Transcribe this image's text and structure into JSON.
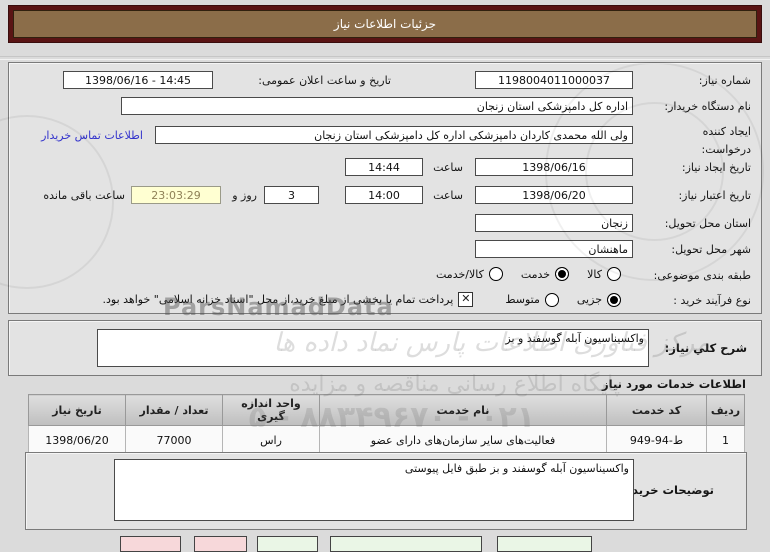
{
  "title_bar": {
    "title": "جزئیات اطلاعات نیاز"
  },
  "form": {
    "need_number": {
      "label": "شماره نیاز:",
      "value": "1198004011000037"
    },
    "announce": {
      "label": "تاریخ و ساعت اعلان عمومی:",
      "value": "1398/06/16 - 14:45"
    },
    "buyer_org": {
      "label": "نام دستگاه خریدار:",
      "value": "اداره کل دامپزشکی استان زنجان"
    },
    "creator": {
      "label": "ایجاد کننده درخواست:",
      "value": "ولی الله محمدی کاردان دامپزشکی  اداره کل دامپزشکی استان زنجان",
      "contact_link": "اطلاعات تماس خریدار"
    },
    "created_date": {
      "label": "تاریخ ایجاد نیاز:",
      "date": "1398/06/16",
      "time_label": "ساعت",
      "time": "14:44"
    },
    "valid_date": {
      "label": "تاریخ اعتبار نیاز:",
      "date": "1398/06/20",
      "time_label": "ساعت",
      "time": "14:00"
    },
    "countdown": {
      "days": "3",
      "days_label": "روز و",
      "time": "23:03:29",
      "time_label": "ساعت باقی مانده"
    },
    "province": {
      "label": "استان محل تحویل:",
      "value": "زنجان"
    },
    "city": {
      "label": "شهر محل تحویل:",
      "value": "ماهنشان"
    },
    "subject_class": {
      "label": "طبقه بندی موضوعی:",
      "options": [
        {
          "label": "کالا",
          "checked": false
        },
        {
          "label": "خدمت",
          "checked": true
        },
        {
          "label": "کالا/خدمت",
          "checked": false
        }
      ]
    },
    "process_type": {
      "label": "نوع فرآیند خرید :",
      "options": [
        {
          "label": "جزیی",
          "checked": true
        },
        {
          "label": "متوسط",
          "checked": false
        }
      ],
      "treasury_checked": true,
      "treasury_note": "پرداخت تمام یا بخشی از مبلغ خرید،از محل \"اسناد خزانه اسلامی\" خواهد بود."
    }
  },
  "need_desc": {
    "label": "شرح كلي نياز:",
    "value": "واکسیناسیون آبله گوسفند و بز"
  },
  "services": {
    "header": "اطلاعات خدمات مورد نياز",
    "table": {
      "columns": [
        "ردیف",
        "کد خدمت",
        "نام خدمت",
        "واحد اندازه گیری",
        "تعداد / مقدار",
        "تاریخ نیاز"
      ],
      "rows": [
        {
          "row_no": "1",
          "code": "ط-94-949",
          "name": "فعالیت‌های سایر سازمان‌های دارای عضو",
          "unit": "راس",
          "qty": "77000",
          "date": "1398/06/20"
        }
      ]
    }
  },
  "buyer_notes": {
    "label": "توضيحات خريدار:",
    "value": "واکسیناسیون آبله گوسفند و بز طبق فایل پیوستی"
  },
  "colors": {
    "titlebar_outer": "#5a1414",
    "titlebar_inner": "#8b6d49",
    "countdown_bg": "#ffffd2",
    "link": "#3333cc"
  },
  "watermark": {
    "brand": "ParsNamadData",
    "line1": "مرکز فناوری اطلاعات پارس نماد داده ها",
    "line2": "پایگاه اطلاع رسانی مناقصه و مزایده",
    "line3": "۵ - ۸۸۳۴۹۶۷۰ - ۰۲۱"
  }
}
